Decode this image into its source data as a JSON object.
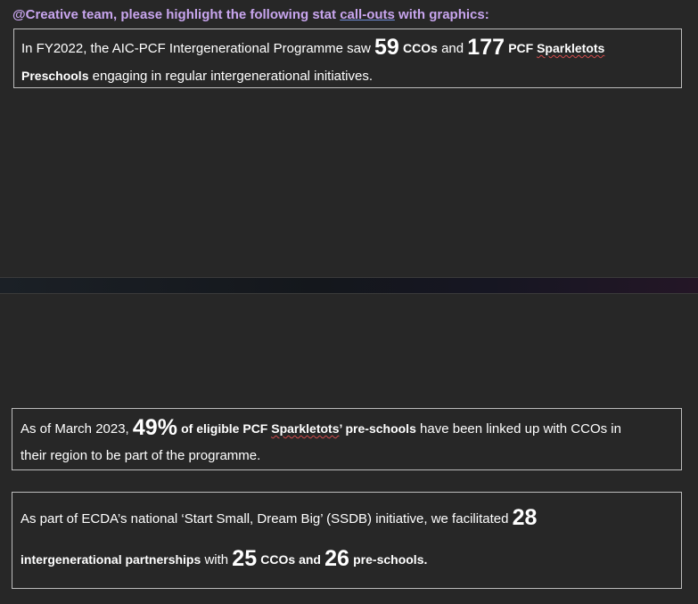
{
  "comment": {
    "before": "@Creative team, please highlight the following stat ",
    "link": "call-outs",
    "after": " with graphics:"
  },
  "callout_1": {
    "t1": "In FY2022, the AIC-PCF Intergenerational Programme saw ",
    "n1": "59",
    "b1": "CCOs",
    "t2": " and ",
    "n2": "177",
    "b2a": "PCF ",
    "b2b": "Sparkletots",
    "b3": "Preschools",
    "t3": " engaging in regular intergenerational initiatives."
  },
  "callout_2": {
    "t1": "As of March 2023, ",
    "n1": "49%",
    "b1a": "of eligible PCF ",
    "b1b": "Sparkletots",
    "b1c": "’ pre-schools",
    "t2": " have been linked up with CCOs in",
    "t3": "their region to be part of the programme."
  },
  "callout_3": {
    "t1": "As part of ECDA’s national ‘Start Small, Dream Big’ (SSDB) initiative, we facilitated ",
    "n1": "28",
    "b1": "intergenerational partnerships",
    "t2": " with ",
    "n2": "25",
    "b2": "CCOs and",
    "n3": "26",
    "b3": "pre-schools."
  }
}
